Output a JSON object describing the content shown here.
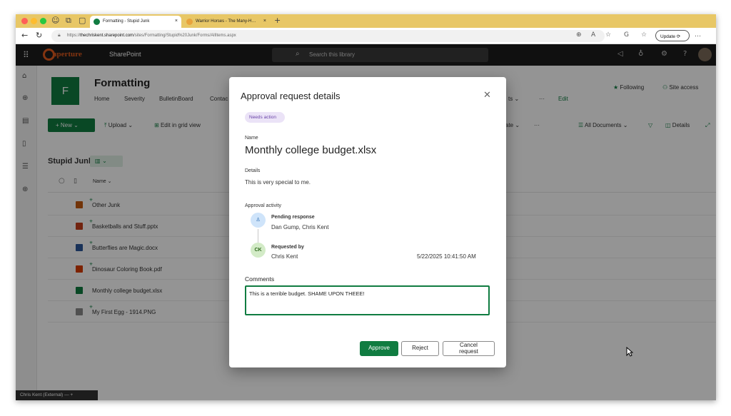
{
  "browser": {
    "tabs": [
      {
        "label": "Formatting - Stupid Junk",
        "close": "×"
      },
      {
        "label": "Warrior Horses - The Many-H…",
        "close": "×"
      }
    ],
    "new_tab": "+",
    "url_prefix": "https://",
    "url_host": "thechriskent.sharepoint.com",
    "url_path": "/sites/Formatting/Stupid%20Junk/Forms/AllItems.aspx",
    "update_label": "Update",
    "more_icon": "…"
  },
  "suite": {
    "logo_text": "aperture",
    "app_name": "SharePoint",
    "search_placeholder": "Search this library",
    "help": "?"
  },
  "site": {
    "tile_letter": "F",
    "title": "Formatting",
    "nav": [
      "Home",
      "Severity",
      "BulletinBoard",
      "Contac",
      "ts ⌄",
      "···",
      "Edit"
    ],
    "following": "Following",
    "site_access": "Site access"
  },
  "command_bar": {
    "new_label": "+  New ⌄",
    "upload": "Upload ⌄",
    "edit_grid": "Edit in grid view",
    "automate": "ate ⌄",
    "more": "···",
    "view": "All Documents ⌄",
    "details": "Details"
  },
  "library": {
    "title": "Stupid Junk",
    "name_header": "Name ⌄",
    "files": [
      {
        "name": "Other Junk",
        "type": "folder",
        "color": "#c55a11",
        "new": true
      },
      {
        "name": "Basketballs and Stuff.pptx",
        "type": "pptx",
        "color": "#c43e1c",
        "new": true
      },
      {
        "name": "Butterflies are Magic.docx",
        "type": "docx",
        "color": "#2b579a",
        "new": true
      },
      {
        "name": "Dinosaur Coloring Book.pdf",
        "type": "pdf",
        "color": "#d83b01",
        "new": true
      },
      {
        "name": "Monthly college budget.xlsx",
        "type": "xlsx",
        "color": "#107c41",
        "new": false
      },
      {
        "name": "My First Egg - 1914.PNG",
        "type": "png",
        "color": "#8a8a8a",
        "new": true
      }
    ]
  },
  "status_tip": "Chris Kent (External)  —  +",
  "modal": {
    "title": "Approval request details",
    "badge": "Needs action",
    "name_label": "Name",
    "file_name": "Monthly college budget.xlsx",
    "details_label": "Details",
    "details_text": "This is very special to me.",
    "activity_label": "Approval activity",
    "pending": {
      "title": "Pending response",
      "names": "Dan Gump, Chris Kent"
    },
    "requested": {
      "initials": "CK",
      "title": "Requested by",
      "name": "Chris Kent",
      "timestamp": "5/22/2025 10:41:50 AM"
    },
    "comments_label": "Comments",
    "comments_value": "This is a terrible budget. SHAME UPON THEEE!",
    "approve_label": "Approve",
    "reject_label": "Reject",
    "cancel_line1": "Cancel",
    "cancel_line2": "request"
  },
  "colors": {
    "accent": "#107c41",
    "badge_bg": "#ebe3f7",
    "badge_text": "#6b45a8",
    "tabbar": "#e8c766"
  }
}
